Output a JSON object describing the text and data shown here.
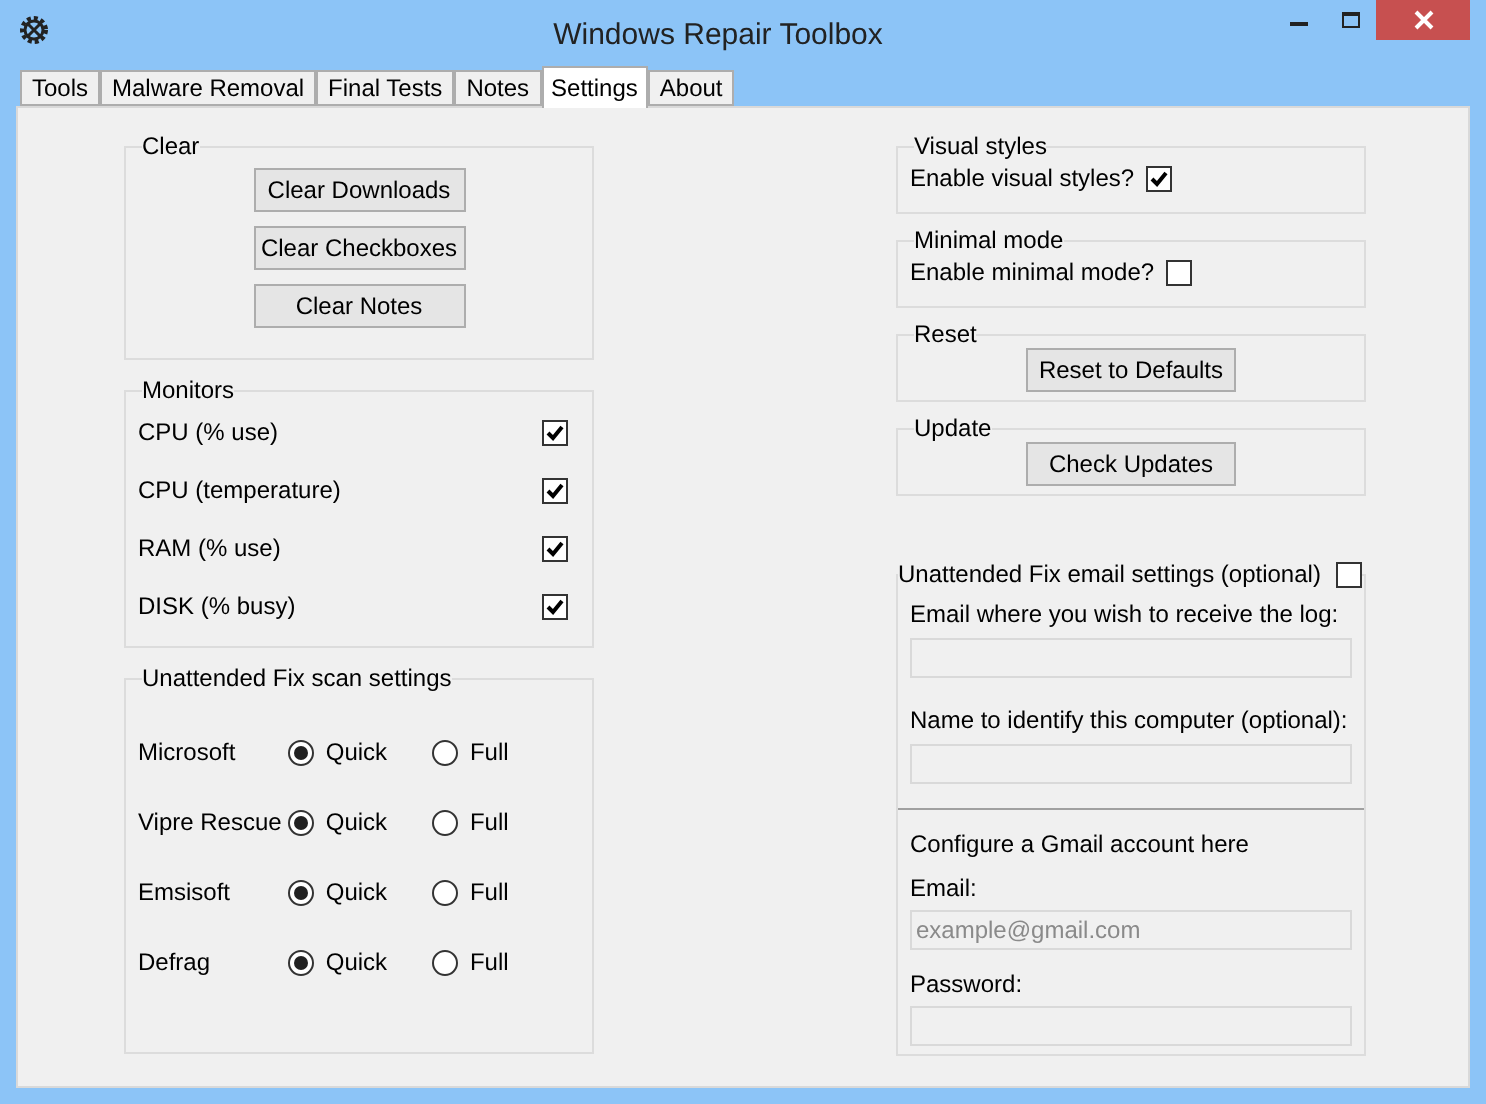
{
  "window": {
    "title": "Windows Repair Toolbox"
  },
  "tabs": [
    {
      "label": "Tools",
      "selected": false
    },
    {
      "label": "Malware Removal",
      "selected": false
    },
    {
      "label": "Final Tests",
      "selected": false
    },
    {
      "label": "Notes",
      "selected": false
    },
    {
      "label": "Settings",
      "selected": true
    },
    {
      "label": "About",
      "selected": false
    }
  ],
  "clear": {
    "title": "Clear",
    "buttons": [
      "Clear Downloads",
      "Clear Checkboxes",
      "Clear Notes"
    ]
  },
  "monitors": {
    "title": "Monitors",
    "items": [
      {
        "label": "CPU (% use)",
        "checked": true
      },
      {
        "label": "CPU (temperature)",
        "checked": true
      },
      {
        "label": "RAM (% use)",
        "checked": true
      },
      {
        "label": "DISK (% busy)",
        "checked": true
      }
    ]
  },
  "scan_settings": {
    "title": "Unattended Fix scan settings",
    "rows": [
      {
        "name": "Microsoft",
        "options": [
          {
            "label": "Quick",
            "selected": true
          },
          {
            "label": "Full",
            "selected": false
          }
        ]
      },
      {
        "name": "Vipre Rescue",
        "options": [
          {
            "label": "Quick",
            "selected": true
          },
          {
            "label": "Full",
            "selected": false
          }
        ]
      },
      {
        "name": "Emsisoft",
        "options": [
          {
            "label": "Quick",
            "selected": true
          },
          {
            "label": "Full",
            "selected": false
          }
        ]
      },
      {
        "name": "Defrag",
        "options": [
          {
            "label": "Quick",
            "selected": true
          },
          {
            "label": "Full",
            "selected": false
          }
        ]
      }
    ]
  },
  "visual_styles": {
    "title": "Visual styles",
    "label": "Enable visual styles?",
    "checked": true
  },
  "minimal_mode": {
    "title": "Minimal mode",
    "label": "Enable minimal mode?",
    "checked": false
  },
  "reset": {
    "title": "Reset",
    "button": "Reset to Defaults"
  },
  "update": {
    "title": "Update",
    "button": "Check Updates"
  },
  "email_settings": {
    "title": "Unattended Fix email settings (optional)",
    "checked": false,
    "fields": [
      {
        "label": "Email where you wish to receive the log:"
      },
      {
        "label": "Name to identify this computer (optional):"
      }
    ],
    "gmail_heading": "Configure a Gmail account here",
    "gmail_fields": [
      {
        "label": "Email:",
        "placeholder": "example@gmail.com"
      },
      {
        "label": "Password:"
      }
    ]
  }
}
